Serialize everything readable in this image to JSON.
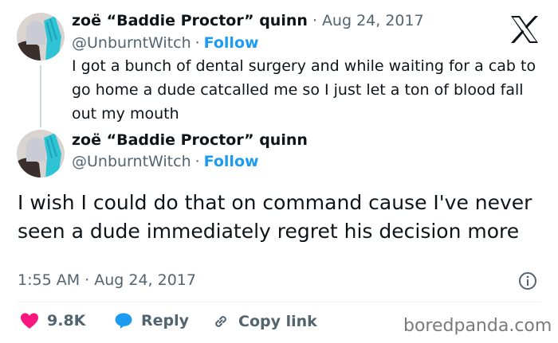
{
  "platform_logo": "x-logo-icon",
  "parent_tweet": {
    "display_name": "zoë “Baddie Proctor” quinn",
    "separator": "·",
    "date": "Aug 24, 2017",
    "handle": "@UnburntWitch",
    "follow_sep": "·",
    "follow_label": "Follow",
    "text": "I got a bunch of dental surgery and while waiting for a cab to go home a dude catcalled me so I just let a ton of blood fall out my mouth"
  },
  "main_tweet": {
    "display_name": "zoë “Baddie Proctor” quinn",
    "handle": "@UnburntWitch",
    "follow_sep": "·",
    "follow_label": "Follow",
    "text": "I wish I could do that on command cause I've never seen a dude immediately regret his decision more",
    "timestamp": "1:55 AM · Aug 24, 2017",
    "info_icon": "info-icon"
  },
  "actions": {
    "like_count": "9.8K",
    "reply_label": "Reply",
    "copy_link_label": "Copy link"
  },
  "watermark": "boredpanda.com",
  "colors": {
    "accent": "#1d9bf0",
    "like": "#f91880",
    "muted": "#536471"
  }
}
